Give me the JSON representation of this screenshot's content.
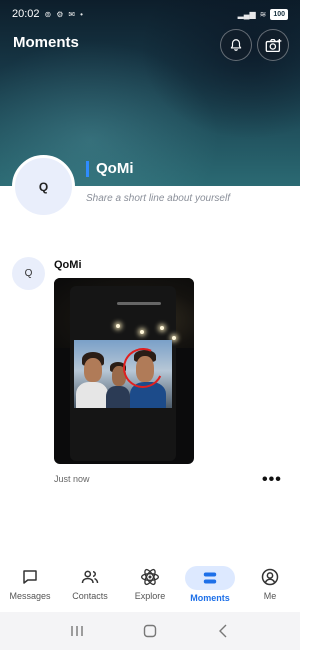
{
  "status_bar": {
    "time": "20:02",
    "battery": "100"
  },
  "header": {
    "title": "Moments"
  },
  "profile": {
    "avatar_initial": "Q",
    "name": "QoMi",
    "bio_placeholder": "Share a short line about yourself"
  },
  "post": {
    "avatar_initial": "Q",
    "author": "QoMi",
    "timestamp": "Just now",
    "more_label": "•••"
  },
  "nav": {
    "items": [
      {
        "label": "Messages",
        "icon": "chat-icon"
      },
      {
        "label": "Contacts",
        "icon": "contacts-icon"
      },
      {
        "label": "Explore",
        "icon": "explore-icon"
      },
      {
        "label": "Moments",
        "icon": "moments-icon",
        "active": true
      },
      {
        "label": "Me",
        "icon": "profile-icon"
      }
    ]
  },
  "colors": {
    "accent": "#1e70e8",
    "accent_bg": "#dde9ff",
    "profile_bar": "#2f8cff"
  }
}
